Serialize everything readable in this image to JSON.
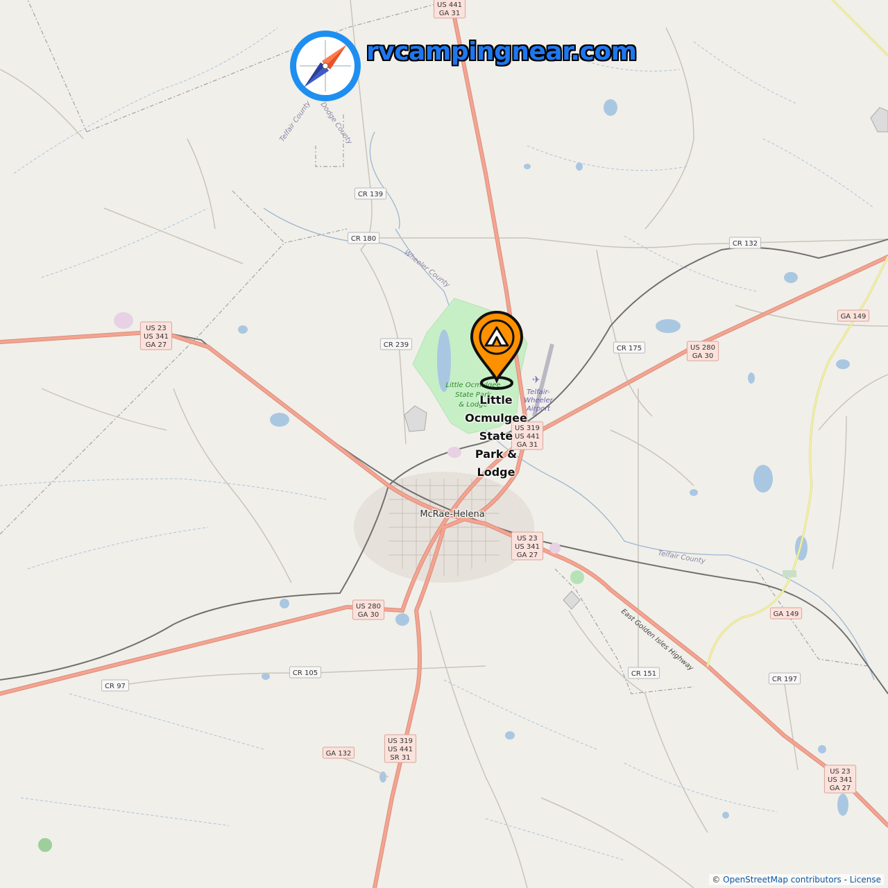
{
  "site": {
    "brand": "rvcampingnear.com",
    "brand_color": "#1f77ee"
  },
  "marker": {
    "icon": "campground-pin-icon",
    "color": "#ff9000",
    "label_lines": [
      "Little",
      "Ocmulgee",
      "State",
      "Park &",
      "Lodge"
    ]
  },
  "map": {
    "place": "McRae-Helena",
    "park_label_lines": [
      "Little Ocmulgee",
      "State Park",
      "& Lodge"
    ],
    "airport_label_lines": [
      "Telfair-",
      "Wheeler",
      "Airport"
    ],
    "county_labels": [
      "Telfair County",
      "Dodge County",
      "Wheeler County",
      "Telfair County"
    ],
    "highway_label": "East Golden Isles Highway",
    "shields": [
      {
        "lines": [
          "US 441",
          "GA 31"
        ]
      },
      {
        "lines": [
          "CR 139"
        ]
      },
      {
        "lines": [
          "CR 180"
        ]
      },
      {
        "lines": [
          "CR 132"
        ]
      },
      {
        "lines": [
          "GA 149"
        ]
      },
      {
        "lines": [
          "US 23",
          "US 341",
          "GA 27"
        ]
      },
      {
        "lines": [
          "CR 239"
        ]
      },
      {
        "lines": [
          "CR 175"
        ]
      },
      {
        "lines": [
          "US 280",
          "GA 30"
        ]
      },
      {
        "lines": [
          "US 319",
          "US 441",
          "GA 31"
        ]
      },
      {
        "lines": [
          "US 23",
          "US 341",
          "GA 27"
        ]
      },
      {
        "lines": [
          "US 280",
          "GA 30"
        ]
      },
      {
        "lines": [
          "GA 149"
        ]
      },
      {
        "lines": [
          "CR 105"
        ]
      },
      {
        "lines": [
          "CR 151"
        ]
      },
      {
        "lines": [
          "CR 97"
        ]
      },
      {
        "lines": [
          "CR 197"
        ]
      },
      {
        "lines": [
          "US 319",
          "US 441",
          "SR 31"
        ]
      },
      {
        "lines": [
          "GA 132"
        ]
      },
      {
        "lines": [
          "US 23",
          "US 341",
          "GA 27"
        ]
      }
    ]
  },
  "attribution": {
    "prefix": "©",
    "link": "OpenStreetMap contributors",
    "separator": "-",
    "license": "License"
  }
}
